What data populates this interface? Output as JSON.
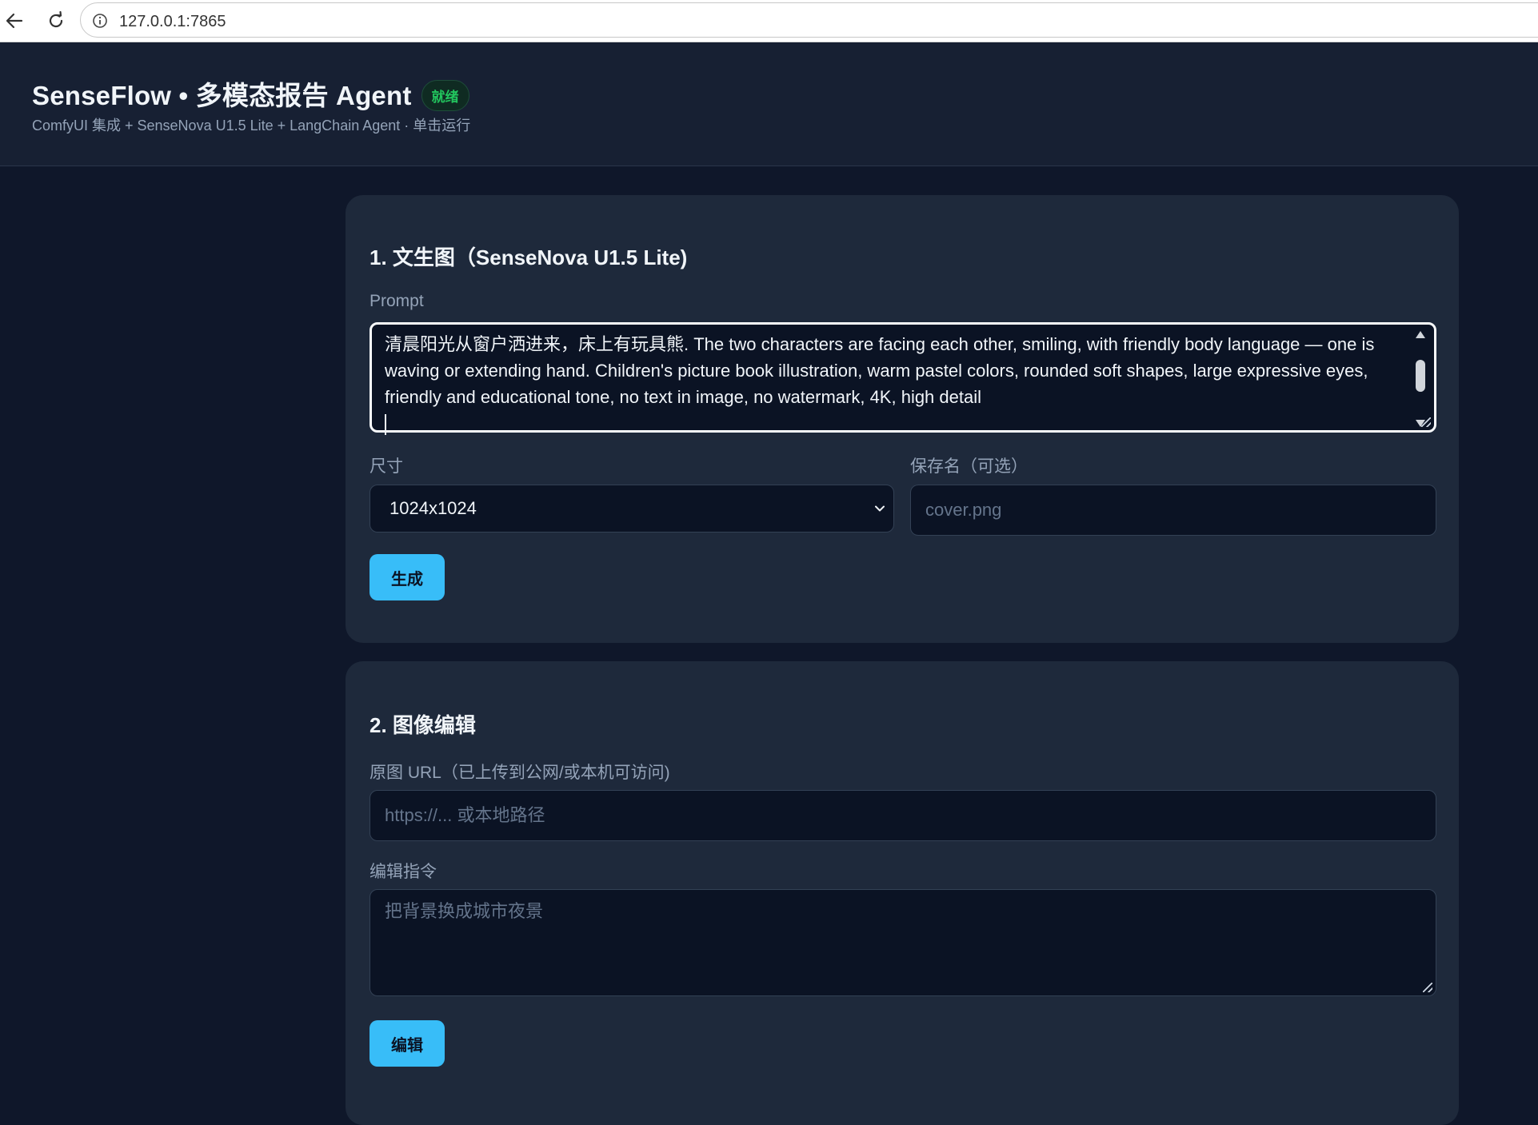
{
  "browser": {
    "url": "127.0.0.1:7865"
  },
  "header": {
    "title": "SenseFlow • 多模态报告 Agent",
    "status_badge": "就绪",
    "subtitle": "ComfyUI 集成 + SenseNova U1.5 Lite + LangChain Agent · 单击运行"
  },
  "text_to_image": {
    "title": "1. 文生图（SenseNova U1.5 Lite)",
    "prompt_label": "Prompt",
    "prompt_value": "清晨阳光从窗户洒进来，床上有玩具熊. The two characters are facing each other, smiling, with friendly body language — one is waving or extending hand. Children's picture book illustration, warm pastel colors, rounded soft shapes, large expressive eyes, friendly and educational tone, no text in image, no watermark, 4K, high detail",
    "size_label": "尺寸",
    "size_value": "1024x1024",
    "save_name_label": "保存名（可选）",
    "save_name_placeholder": "cover.png",
    "generate_button": "生成"
  },
  "image_edit": {
    "title": "2. 图像编辑",
    "url_label": "原图 URL（已上传到公网/或本机可访问)",
    "url_placeholder": "https://... 或本地路径",
    "instruction_label": "编辑指令",
    "instruction_placeholder": "把背景换成城市夜景",
    "edit_button": "编辑"
  },
  "colors": {
    "page_bg": "#0f172a",
    "card_bg": "#1e293b",
    "accent": "#38bdf8",
    "status_green": "#22c55e"
  }
}
